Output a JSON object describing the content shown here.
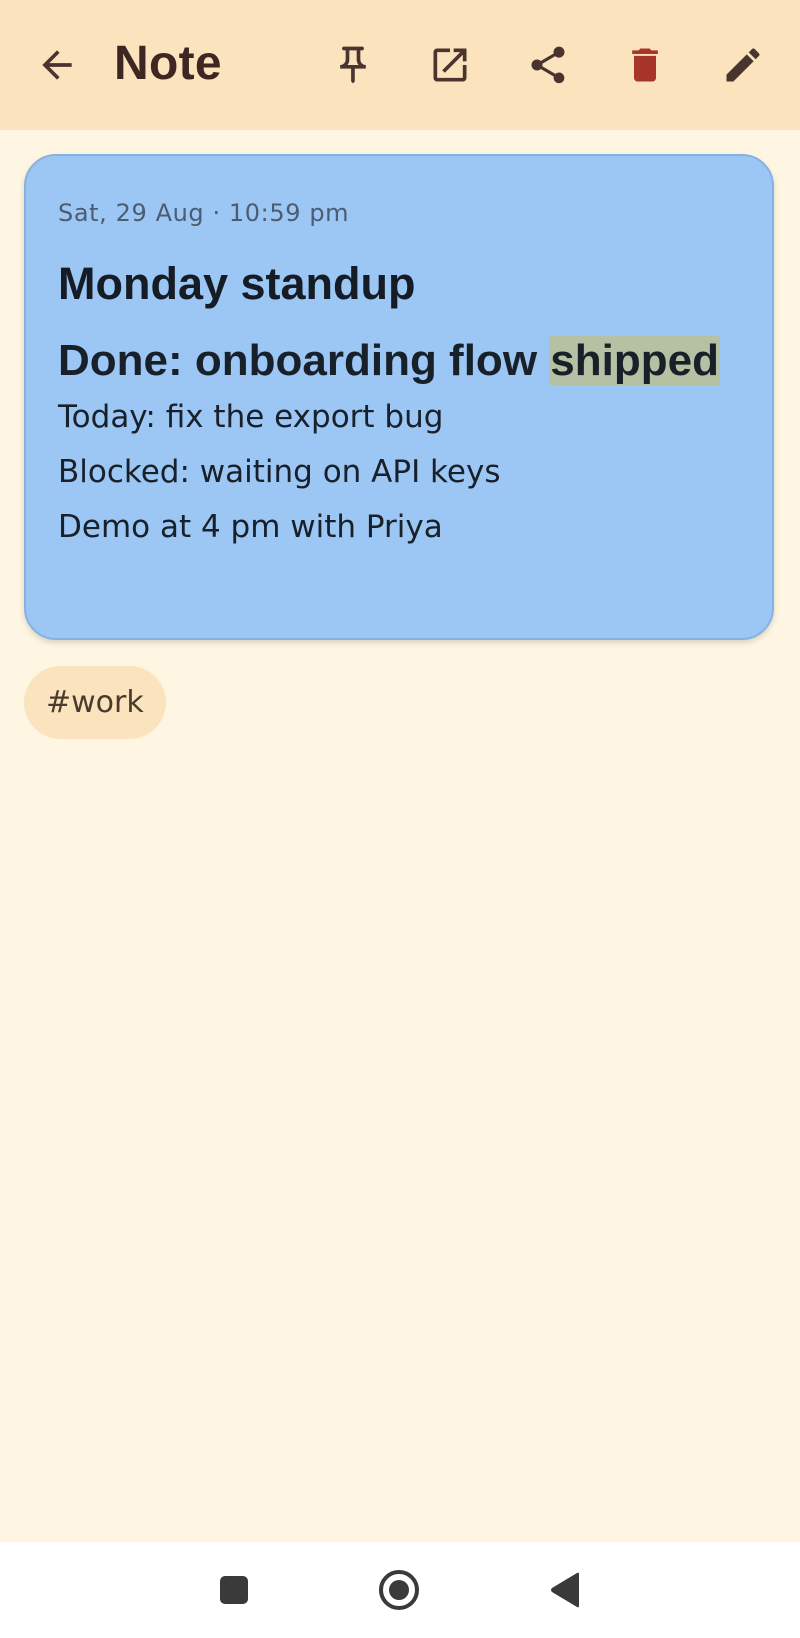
{
  "appbar": {
    "title": "Note",
    "icons": [
      "back-arrow-icon",
      "pin-icon",
      "open-in-new-icon",
      "share-icon",
      "delete-icon",
      "edit-icon"
    ],
    "colors": {
      "background": "#fbe3bd",
      "icon": "#4a3430",
      "delete_icon": "#a8352a"
    }
  },
  "note": {
    "date": "Sat, 29 Aug · 10:59 pm",
    "title": "Monday standup",
    "lines": [
      {
        "text_before": "Done: onboarding flow ",
        "highlight": "shipped"
      },
      {
        "text": "Today: fix the export bug"
      },
      {
        "text": "Blocked: waiting on API keys"
      },
      {
        "text": "Demo at 4 pm with Priya"
      }
    ],
    "colors": {
      "card": "#9cc6f4",
      "highlight": "#b6c1a4"
    }
  },
  "tags": [
    {
      "label": "#work"
    }
  ],
  "system_nav": {
    "icons": [
      "recents-square-icon",
      "home-circle-icon",
      "back-triangle-icon"
    ]
  },
  "colors": {
    "page_background": "#fef6e2"
  }
}
